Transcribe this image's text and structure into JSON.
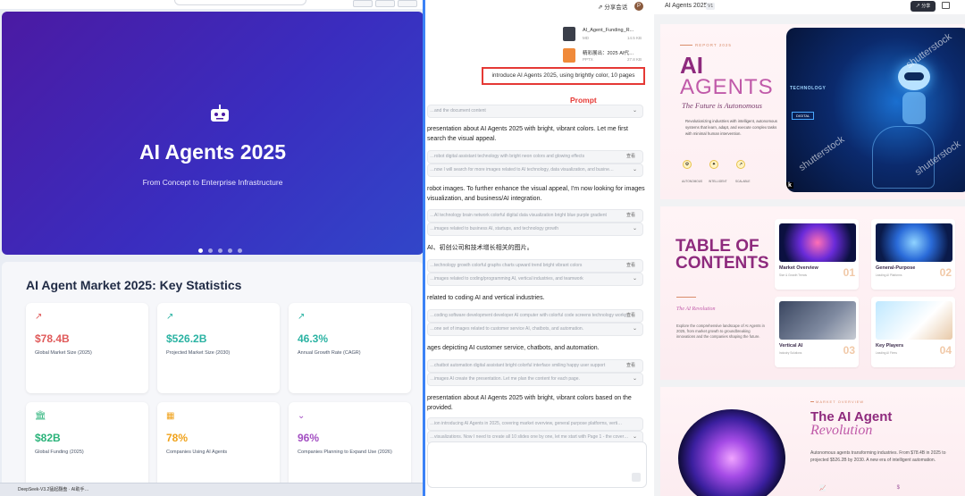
{
  "left": {
    "hero": {
      "title": "AI Agents 2025",
      "subtitle": "From Concept to Enterprise Infrastructure"
    },
    "stats_title": "AI Agent Market 2025: Key Statistics",
    "cards": [
      {
        "icon": "trend-up-icon",
        "value": "$78.4B",
        "label": "Global Market Size (2025)",
        "color": "#e05a5a"
      },
      {
        "icon": "trend-up-icon",
        "value": "$526.2B",
        "label": "Projected Market Size (2030)",
        "color": "#2bb3a3"
      },
      {
        "icon": "trend-up-icon",
        "value": "46.3%",
        "label": "Annual Growth Rate (CAGR)",
        "color": "#2bb3a3"
      },
      {
        "icon": "bank-icon",
        "value": "$82B",
        "label": "Global Funding (2025)",
        "color": "#2bb37a"
      },
      {
        "icon": "building-icon",
        "value": "78%",
        "label": "Companies Using AI Agents",
        "color": "#f0a21b"
      },
      {
        "icon": "chevron-icon",
        "value": "96%",
        "label": "Companies Planning to Expand Use (2026)",
        "color": "#a34fc2"
      }
    ],
    "taskbar": "DeepSeek-V3.2猛起翻盘 · AI助手…"
  },
  "mid": {
    "share_label": "分享会话",
    "avatar": "P",
    "files": [
      {
        "name": "AI_Agent_Funding_R...",
        "type": "MD",
        "size": "14.5 KB"
      },
      {
        "name": "精彩展出：2025 AI代…",
        "type": "PPTX",
        "size": "27.8 KB"
      }
    ],
    "prompt_text": "introduce AI Agents 2025, using brightly color, 10 pages",
    "prompt_label": "Prompt",
    "step_read": "…and the document content",
    "para1": "presentation about AI Agents 2025 with bright, vibrant colors. Let me first search the visual appeal.",
    "step2": "…robot digital assistant technology with bright neon colors and glowing effects",
    "step2b": "…now I will search for more images related to AI technology, data visualization, and busine…",
    "para2": "robot images. To further enhance the visual appeal, I'm now looking for images visualization, and business/AI integration.",
    "step3": "…AI technology brain network colorful digital data visualization bright blue purple gradient",
    "step3b": "…images related to business AI, startups, and technology growth",
    "para3": "AI、初创公司和技术增长相关的图片。",
    "step4": "…technology growth colorful graphs charts upward trend bright vibrant colors",
    "step4b": "…images related to coding/programming AI, vertical industries, and teamwork",
    "para4": "related to coding AI and vertical industries.",
    "step5": "…coding software development developer AI computer with colorful code screens technology workp…",
    "step5b": "…one set of images related to customer service AI, chatbots, and automation.",
    "para5": "ages depicting AI customer service, chatbots, and automation.",
    "step6": "…chatbot automation digital assistant bright colorful interface smiling happy user support",
    "step6b": "…images AI create the presentation. Let me plan the content for each page.",
    "para6": "presentation about AI Agents 2025 with bright, vibrant colors based on the provided.",
    "step7": "…ion introducing AI Agents in 2025, covering market overview, general purpose platforms, verti…",
    "step7b": "…visualizations. Now I need to create all 10 slides one by one, let me start with Page 1 - the cover…",
    "tag": "查看"
  },
  "right": {
    "title": "AI Agents 2025",
    "version": "V1",
    "share": "分享",
    "slide1": {
      "report": "REPORT 2025",
      "ai": "AI",
      "agents": "AGENTS",
      "tagline": "The Future is Autonomous",
      "desc": "Revolutionizing industries with intelligent, autonomous systems that learn, adapt, and execute complex tasks with minimal human intervention.",
      "icons": [
        "AUTONOMOUS",
        "INTELLIGENT",
        "SCALABLE"
      ],
      "tech": "TECHNOLOGY",
      "digital": "DIGITAL",
      "wm": "shutterstock"
    },
    "slide2": {
      "title": "TABLE OF CONTENTS",
      "rev": "The AI Revolution",
      "desc": "Explore the comprehensive landscape of AI Agents in 2025, from market growth to groundbreaking innovations and the companies shaping the future.",
      "items": [
        {
          "title": "Market Overview",
          "sub": "Size & Growth Trends",
          "num": "01"
        },
        {
          "title": "General-Purpose",
          "sub": "Leading AI Platforms",
          "num": "02"
        },
        {
          "title": "Vertical AI",
          "sub": "Industry Solutions",
          "num": "03"
        },
        {
          "title": "Key Players",
          "sub": "Leading AI Firms",
          "num": "04"
        }
      ]
    },
    "slide3": {
      "over": "MARKET OVERVIEW",
      "title": "The AI Agent",
      "rev": "Revolution",
      "desc": "Autonomous agents transforming industries. From $78.4B in 2025 to projected $526.2B by 2030. A new era of intelligent automation."
    }
  }
}
